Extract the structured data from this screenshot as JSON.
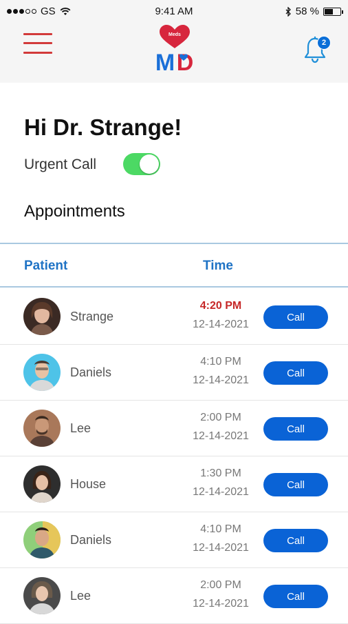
{
  "status_bar": {
    "carrier": "GS",
    "time": "9:41 AM",
    "battery_text": "58 %",
    "battery_level": 0.58
  },
  "header": {
    "menu_icon": "hamburger-icon",
    "logo_text": "MD",
    "logo_small": "Meds",
    "notification_icon": "bell-icon",
    "notification_count": "2"
  },
  "colors": {
    "brand_red": "#d23a3a",
    "brand_blue": "#0a63d6",
    "toggle_on": "#4cd964",
    "urgent_time": "#c62828",
    "header_blue": "#1f73c5"
  },
  "greeting": "Hi Dr. Strange!",
  "urgent_call": {
    "label": "Urgent Call",
    "enabled": true
  },
  "appointments": {
    "title": "Appointments",
    "columns": {
      "patient": "Patient",
      "time": "Time"
    },
    "rows": [
      {
        "name": "Strange",
        "time": "4:20 PM",
        "date": "12-14-2021",
        "urgent": true,
        "action": "Call"
      },
      {
        "name": "Daniels",
        "time": "4:10 PM",
        "date": "12-14-2021",
        "urgent": false,
        "action": "Call"
      },
      {
        "name": "Lee",
        "time": "2:00 PM",
        "date": "12-14-2021",
        "urgent": false,
        "action": "Call"
      },
      {
        "name": "House",
        "time": "1:30 PM",
        "date": "12-14-2021",
        "urgent": false,
        "action": "Call"
      },
      {
        "name": "Daniels",
        "time": "4:10 PM",
        "date": "12-14-2021",
        "urgent": false,
        "action": "Call"
      },
      {
        "name": "Lee",
        "time": "2:00 PM",
        "date": "12-14-2021",
        "urgent": false,
        "action": "Call"
      }
    ]
  }
}
